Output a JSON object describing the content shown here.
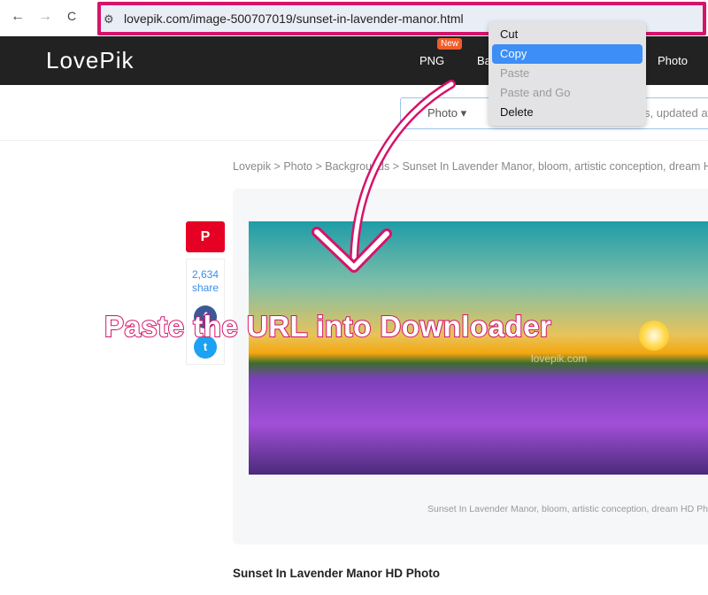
{
  "browser": {
    "url": "lovepik.com/image-500707019/sunset-in-lavender-manor.html",
    "back": "←",
    "forward": "→",
    "reload": "C"
  },
  "site": {
    "logo": "LovePik",
    "nav": [
      "PNG",
      "Ba",
      "Photo"
    ],
    "new_badge": "New",
    "search": {
      "category": "Photo",
      "placeholder": "s, updated at"
    }
  },
  "breadcrumb": "Lovepik > Photo > Backgrounds > Sunset In Lavender Manor, bloom, artistic conception, dream HD",
  "share": {
    "count": "2,634",
    "label": "share",
    "pin": "P",
    "fb": "f",
    "tw": "t"
  },
  "photo": {
    "watermark": "lovepik.com",
    "caption": "Sunset In Lavender Manor, bloom, artistic conception, dream HD Ph"
  },
  "heading": "Sunset In Lavender Manor HD Photo",
  "context_menu": [
    {
      "label": "Cut"
    },
    {
      "label": "Copy"
    },
    {
      "label": "Paste"
    },
    {
      "label": "Paste and Go"
    },
    {
      "label": "Delete"
    }
  ],
  "annotation": "Paste the URL into Downloader",
  "colors": {
    "accent": "#d6136b",
    "highlight": "#3d8ef5"
  }
}
